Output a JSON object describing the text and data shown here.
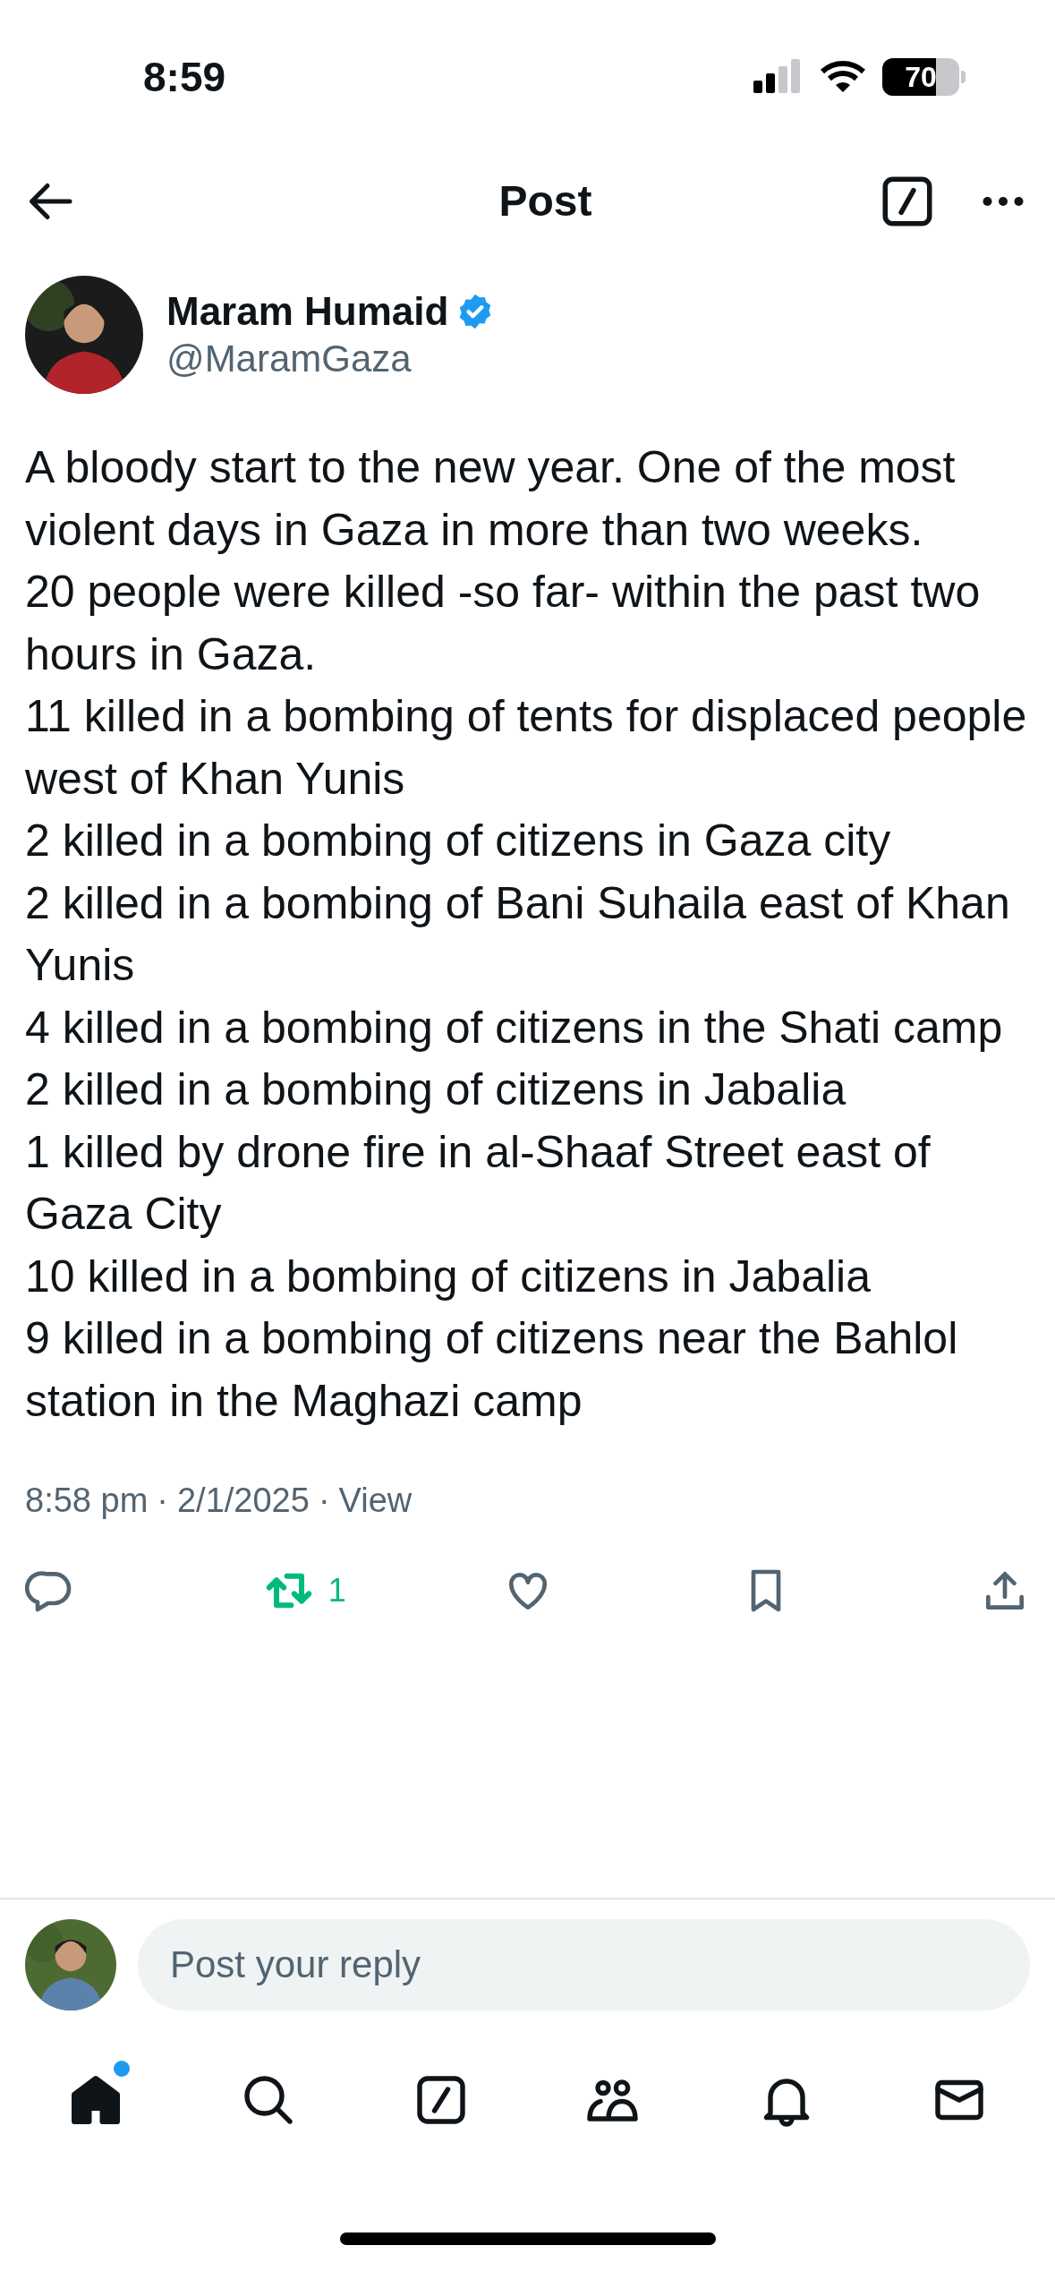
{
  "status_bar": {
    "time": "8:59",
    "battery": "70"
  },
  "header": {
    "title": "Post"
  },
  "post": {
    "author": {
      "name": "Maram Humaid",
      "handle": "@MaramGaza",
      "verified": true
    },
    "lines": [
      "A bloody start to the new year. One of the most violent days in Gaza in more than two weeks.",
      "20 people were killed -so far- within the past two hours in Gaza.",
      "11 killed in a bombing of tents for displaced people west of Khan Yunis",
      "2 killed in a bombing of citizens in Gaza city",
      "2 killed in a bombing of Bani Suhaila east of Khan Yunis",
      "4 killed in a bombing of citizens in the Shati camp",
      "2 killed in a bombing of citizens in Jabalia",
      "1 killed by drone fire in al-Shaaf Street east of Gaza City",
      "10 killed in a bombing of citizens in Jabalia",
      "9 killed in a bombing of citizens near the Bahlol station in the Maghazi camp"
    ],
    "time": "8:58 pm",
    "separator_1": "·",
    "date": "2/1/2025",
    "separator_2": "·",
    "view_link": "View",
    "actions": [
      {
        "kind": "reply",
        "selected": false
      },
      {
        "kind": "repost",
        "selected": true,
        "count": "1"
      },
      {
        "kind": "like",
        "selected": false
      },
      {
        "kind": "bookmark",
        "selected": false
      },
      {
        "kind": "share",
        "selected": false
      }
    ]
  },
  "reply": {
    "placeholder": "Post your reply"
  },
  "nav": [
    {
      "kind": "home",
      "selected": true,
      "dot": true
    },
    {
      "kind": "search",
      "selected": false,
      "dot": false
    },
    {
      "kind": "grok",
      "selected": false,
      "dot": false
    },
    {
      "kind": "communities",
      "selected": false,
      "dot": false
    },
    {
      "kind": "notifications",
      "selected": false,
      "dot": false
    },
    {
      "kind": "messages",
      "selected": false,
      "dot": false
    }
  ]
}
